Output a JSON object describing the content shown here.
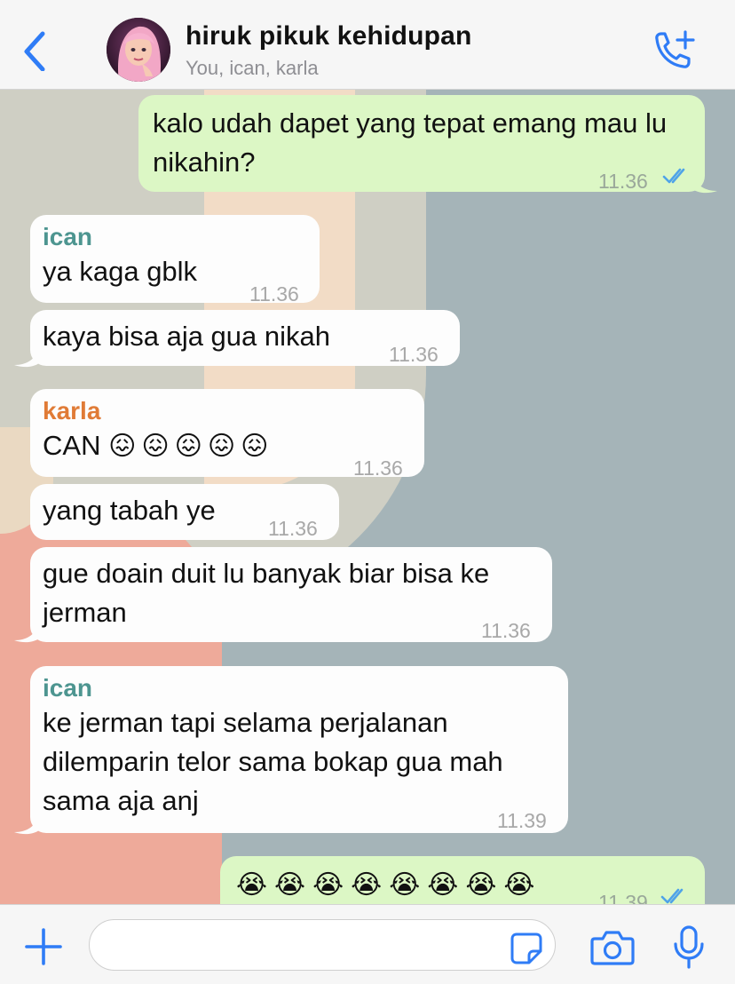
{
  "header": {
    "title": "hiruk pikuk kehidupan",
    "subtitle": "You, ican, karla"
  },
  "colors": {
    "accent": "#2f7cf6",
    "outgoing_bubble": "#dcf7c5",
    "incoming_bubble": "#fdfdfd",
    "ican_name": "#4d9590",
    "karla_name": "#e07b36",
    "read_ticks": "#4fa3e8"
  },
  "messages": [
    {
      "direction": "out",
      "text": "kalo udah dapet yang tepat emang mau lu nikahin?",
      "time": "11.36",
      "status": "read"
    },
    {
      "direction": "in",
      "sender": "ican",
      "text": "ya kaga gblk",
      "time": "11.36"
    },
    {
      "direction": "in",
      "text": "kaya bisa aja gua nikah",
      "time": "11.36"
    },
    {
      "direction": "in",
      "sender": "karla",
      "text": "CAN",
      "emoji": "😖😖😖😖😖",
      "time": "11.36"
    },
    {
      "direction": "in",
      "text": "yang tabah ye",
      "time": "11.36"
    },
    {
      "direction": "in",
      "text": "gue doain duit lu banyak biar bisa ke jerman",
      "time": "11.36"
    },
    {
      "direction": "in",
      "sender": "ican",
      "text": "ke jerman tapi selama perjalanan dilemparin telor sama bokap gua mah sama aja anj",
      "time": "11.39"
    },
    {
      "direction": "out",
      "emoji": "😭😭😭😭😭😭😭😭",
      "time": "11.39",
      "status": "read"
    }
  ],
  "composer": {
    "value": "",
    "placeholder": ""
  },
  "icons": {
    "back": "chevron-left-icon",
    "call": "phone-plus-icon",
    "attach": "plus-icon",
    "sticker": "sticker-icon",
    "camera": "camera-icon",
    "mic": "microphone-icon"
  }
}
